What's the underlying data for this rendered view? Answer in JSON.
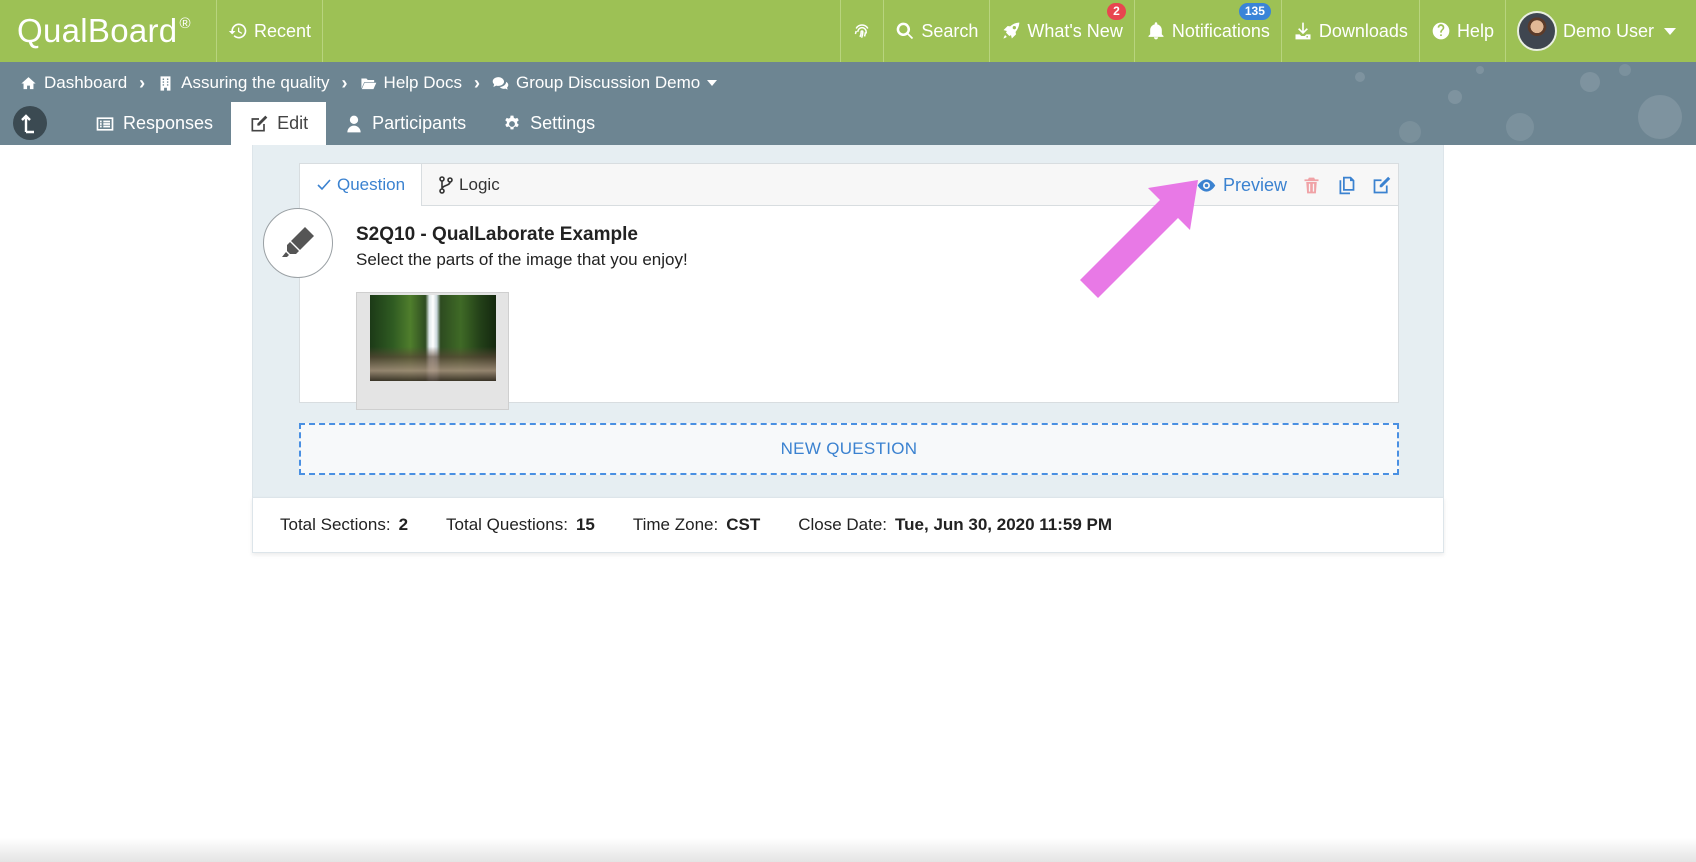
{
  "topbar": {
    "brand": "QualBoard",
    "brand_mark": "®",
    "recent": "Recent",
    "search": "Search",
    "whats_new": "What's New",
    "whats_new_badge": "2",
    "notifications": "Notifications",
    "notifications_badge": "135",
    "downloads": "Downloads",
    "help": "Help",
    "user": "Demo User"
  },
  "breadcrumb": {
    "items": [
      "Dashboard",
      "Assuring the quality",
      "Help Docs",
      "Group Discussion Demo"
    ]
  },
  "tabs": {
    "responses": "Responses",
    "edit": "Edit",
    "participants": "Participants",
    "settings": "Settings",
    "active": "Edit"
  },
  "question_card": {
    "tab_question": "Question",
    "tab_logic": "Logic",
    "preview": "Preview",
    "title": "S2Q10 - QualLaborate Example",
    "text": "Select the parts of the image that you enjoy!",
    "image_desc": "waterfall-thumbnail"
  },
  "new_question": "NEW QUESTION",
  "stats": {
    "sections_label": "Total Sections:",
    "sections_value": "2",
    "questions_label": "Total Questions:",
    "questions_value": "15",
    "tz_label": "Time Zone:",
    "tz_value": "CST",
    "close_label": "Close Date:",
    "close_value": "Tue, Jun 30, 2020 11:59 PM"
  },
  "colors": {
    "topbar": "#9dc155",
    "subbar": "#6d8592",
    "accent": "#3b82d0",
    "arrow": "#e879e6",
    "danger": "#e8464f"
  }
}
